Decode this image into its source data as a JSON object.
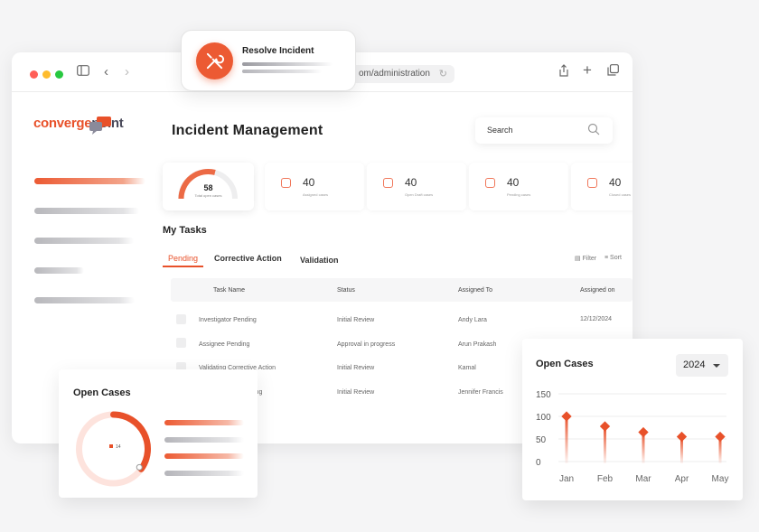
{
  "popup": {
    "title": "Resolve Incident"
  },
  "browser": {
    "url": "om/administration"
  },
  "brand": {
    "part1": "converge",
    "part2": "point",
    "accent": "#e8512a"
  },
  "header": {
    "title": "Incident Management",
    "search_placeholder": "Search"
  },
  "summary": {
    "gauge": {
      "value": "58",
      "label": "Total open cases",
      "fraction": 0.58
    },
    "cards": [
      {
        "value": "40",
        "caption": "Assigned cases"
      },
      {
        "value": "40",
        "caption": "Open Draft cases"
      },
      {
        "value": "40",
        "caption": "Pending cases"
      },
      {
        "value": "40",
        "caption": "Closed cases"
      }
    ]
  },
  "tasks": {
    "title": "My Tasks",
    "tabs": [
      "Pending",
      "Corrective Action",
      "Validation"
    ],
    "filter_label": "Filter",
    "sort_label": "Sort",
    "columns": [
      "Task Name",
      "Status",
      "Assigned To",
      "Assigned on"
    ],
    "rows": [
      {
        "name": "Investigator Pending",
        "status": "Initial Review",
        "assignee": "Andy Lara",
        "date": "12/12/2024"
      },
      {
        "name": "Assignee Pending",
        "status": "Approval in progress",
        "assignee": "Arun Prakash",
        "date": ""
      },
      {
        "name": "Validating Corrective Action",
        "status": "Initial Review",
        "assignee": "Kamal",
        "date": ""
      },
      {
        "name": "ing",
        "status": "Initial Review",
        "assignee": "Jennifer Francis",
        "date": ""
      }
    ]
  },
  "open_cases_small": {
    "title": "Open Cases",
    "center_value": "14",
    "fraction": 0.35
  },
  "open_cases_chart": {
    "year": "2024",
    "chart_data": {
      "type": "line",
      "categories": [
        "Jan",
        "Feb",
        "Mar",
        "Apr",
        "May"
      ],
      "values": [
        100,
        78,
        65,
        55,
        55
      ],
      "yticks": [
        0,
        50,
        100,
        150
      ],
      "ylim": [
        0,
        150
      ],
      "grid": true,
      "color": "#e8512a"
    }
  }
}
